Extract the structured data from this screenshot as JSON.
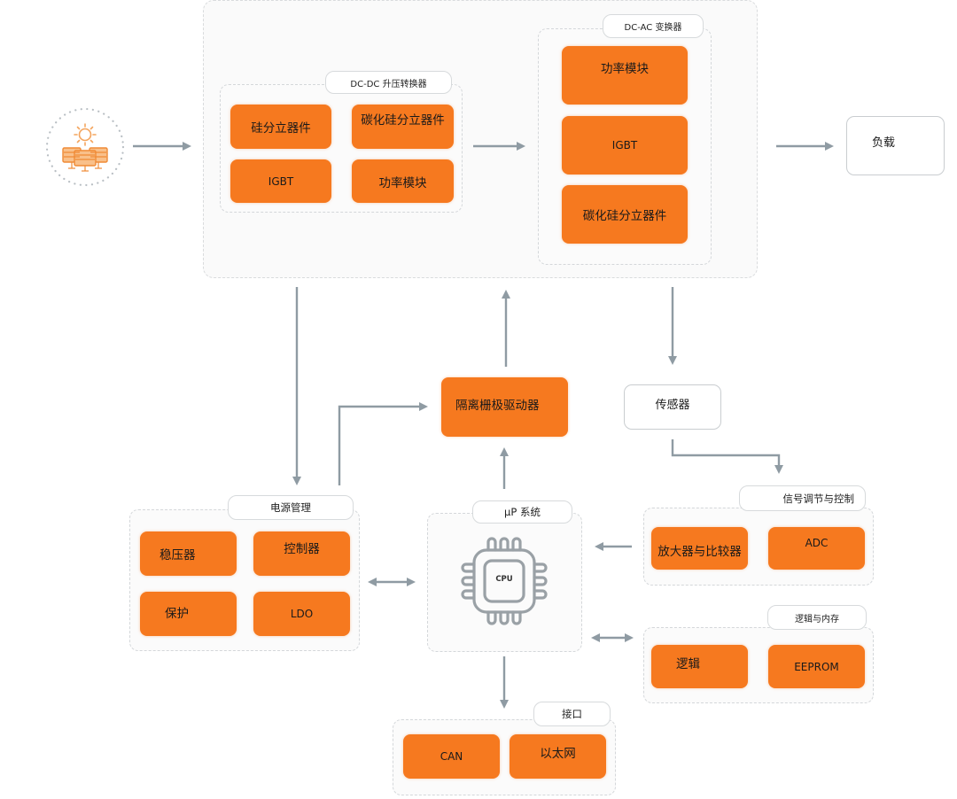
{
  "diagram": {
    "colors": {
      "accent": "#f6791f",
      "arrow": "#8f9ba3",
      "border": "#d4d7da"
    },
    "source": {
      "icon": "solar-panel-icon"
    },
    "dcdc": {
      "title": "DC-DC 升压转换器",
      "blocks": [
        "硅分立器件",
        "碳化硅分立器件",
        "IGBT",
        "功率模块"
      ]
    },
    "dcac": {
      "title": "DC-AC 变换器",
      "blocks": [
        "功率模块",
        "IGBT",
        "碳化硅分立器件"
      ]
    },
    "load": "负载",
    "gate_driver": "隔离栅极驱动器",
    "sensor": "传感器",
    "power_mgmt": {
      "title": "电源管理",
      "blocks": [
        "稳压器",
        "控制器",
        "保护",
        "LDO"
      ]
    },
    "up_system": {
      "title": "μP 系统",
      "cpu_label": "CPU"
    },
    "signal": {
      "title": "信号调节与控制",
      "blocks": [
        "放大器与比较器",
        "ADC"
      ]
    },
    "logic_mem": {
      "title": "逻辑与内存",
      "blocks": [
        "逻辑",
        "EEPROM"
      ]
    },
    "interface": {
      "title": "接口",
      "blocks": [
        "CAN",
        "以太网"
      ]
    }
  }
}
